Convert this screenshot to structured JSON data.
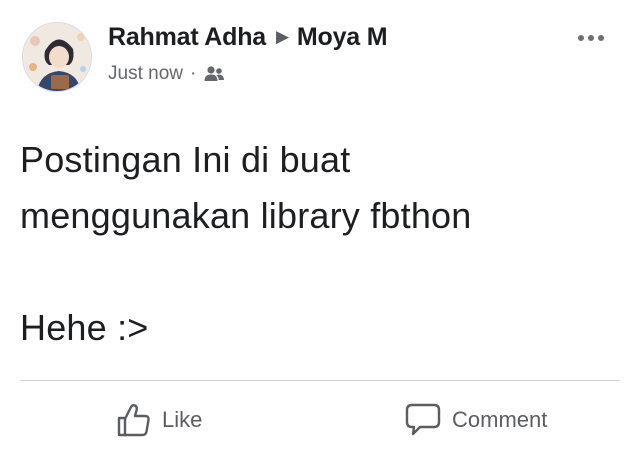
{
  "post": {
    "author": "Rahmat Adha",
    "recipient": "Moya M",
    "arrow": "▶",
    "timestamp": "Just now",
    "separator": "·",
    "audience_icon": "friends-icon",
    "more_icon": "more-options-icon",
    "body": "Postingan Ini di buat\nmenggunakan library fbthon\n\nHehe :>"
  },
  "actions": {
    "like_label": "Like",
    "like_icon": "like-thumb-icon",
    "comment_label": "Comment",
    "comment_icon": "comment-bubble-icon"
  },
  "colors": {
    "text": "#1c1e21",
    "secondary": "#65676b",
    "divider": "#cfd2d6",
    "background": "#ffffff"
  }
}
